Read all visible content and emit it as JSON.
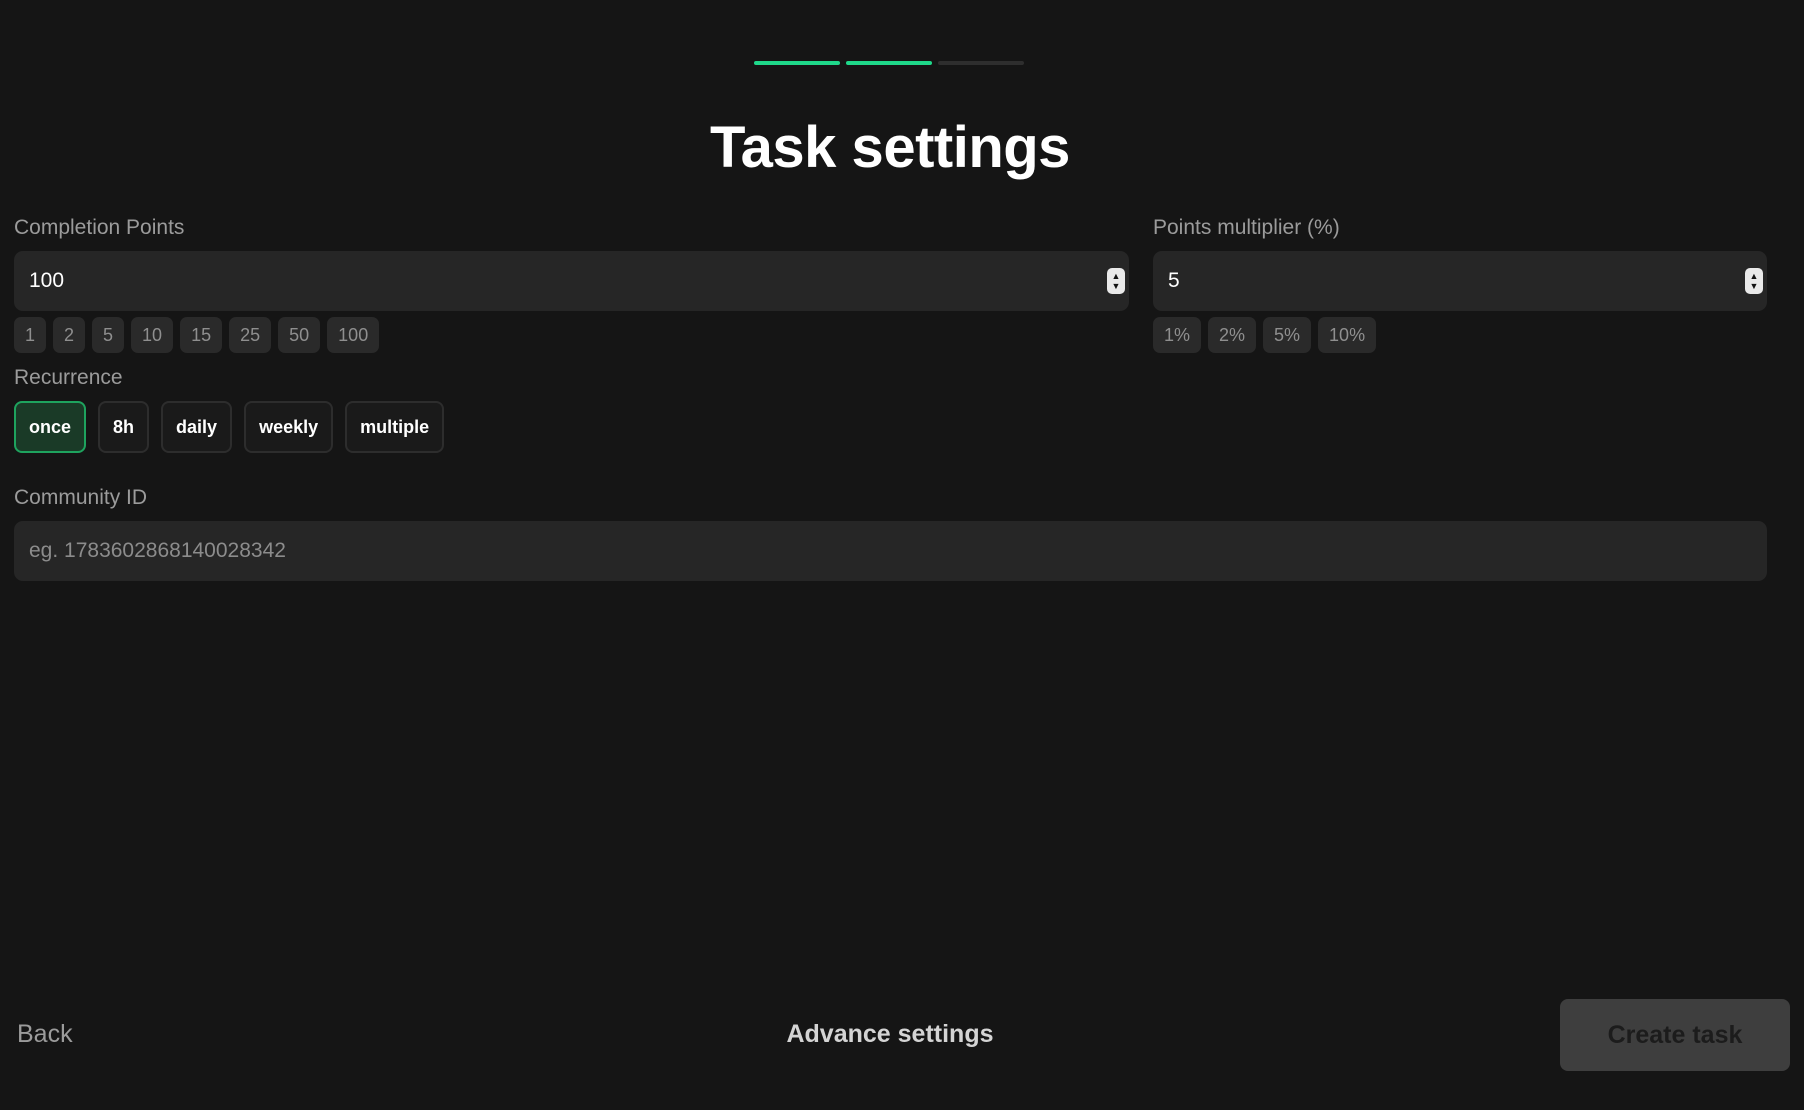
{
  "progress": {
    "total_steps": 3,
    "completed_steps": 2
  },
  "page": {
    "title": "Task settings"
  },
  "completion_points": {
    "label": "Completion Points",
    "value": "100",
    "presets": [
      "1",
      "2",
      "5",
      "10",
      "15",
      "25",
      "50",
      "100"
    ]
  },
  "points_multiplier": {
    "label": "Points multiplier (%)",
    "value": "5",
    "presets": [
      "1%",
      "2%",
      "5%",
      "10%"
    ]
  },
  "recurrence": {
    "label": "Recurrence",
    "options": [
      "once",
      "8h",
      "daily",
      "weekly",
      "multiple"
    ],
    "selected": "once"
  },
  "community_id": {
    "label": "Community ID",
    "placeholder": "eg. 1783602868140028342"
  },
  "footer": {
    "back_label": "Back",
    "advanced_label": "Advance settings",
    "create_label": "Create task"
  },
  "colors": {
    "accent": "#1fd88a",
    "selected_border": "#1ea35e",
    "background": "#151515"
  },
  "icons": {
    "stepper": "up-down-stepper-icon"
  }
}
